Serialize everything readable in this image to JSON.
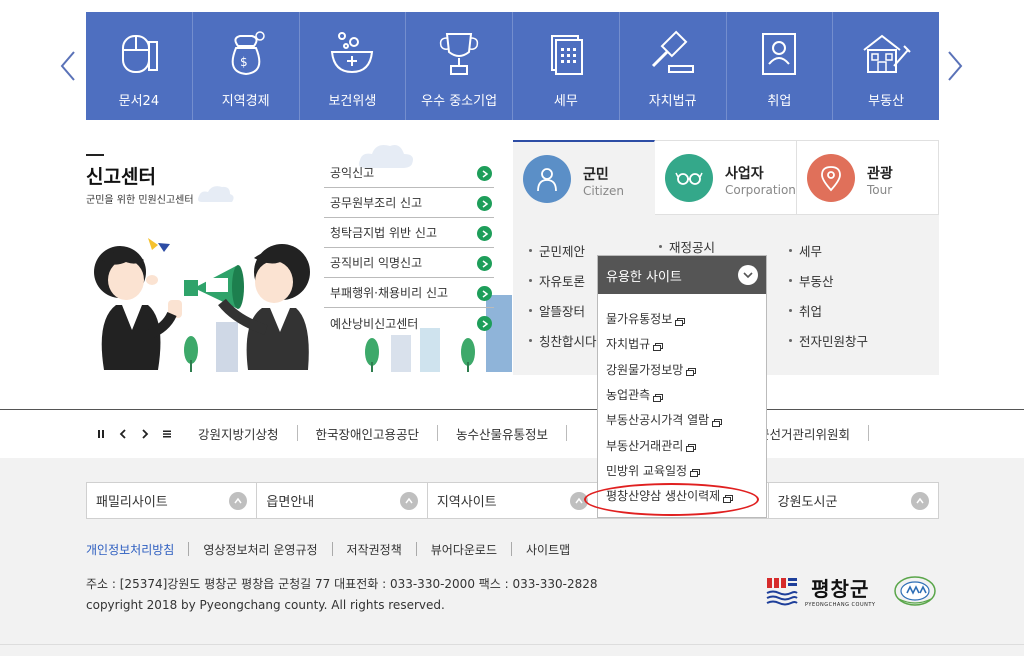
{
  "quick_menu": {
    "items": [
      {
        "label": "문서24",
        "icon": "mouse-document-icon"
      },
      {
        "label": "지역경제",
        "icon": "money-bag-icon"
      },
      {
        "label": "보건위생",
        "icon": "medicine-bowl-icon"
      },
      {
        "label": "우수 중소기업",
        "icon": "trophy-icon"
      },
      {
        "label": "세무",
        "icon": "tax-document-icon"
      },
      {
        "label": "자치법규",
        "icon": "gavel-icon"
      },
      {
        "label": "취업",
        "icon": "id-card-icon"
      },
      {
        "label": "부동산",
        "icon": "house-icon"
      }
    ]
  },
  "report_center": {
    "title": "신고센터",
    "subtitle": "군민을 위한 민원신고센터",
    "links": [
      "공익신고",
      "공무원부조리 신고",
      "청탁금지법 위반 신고",
      "공직비리 익명신고",
      "부패행위·채용비리 신고",
      "예산낭비신고센터"
    ]
  },
  "tabs": {
    "items": [
      {
        "name": "군민",
        "eng": "Citizen",
        "color": "#5b8fc7"
      },
      {
        "name": "사업자",
        "eng": "Corporation",
        "color": "#34a88a"
      },
      {
        "name": "관광",
        "eng": "Tour",
        "color": "#e0705a"
      }
    ],
    "col1": [
      "군민제안",
      "자유토론",
      "알뜰장터",
      "칭찬합시다"
    ],
    "col2": [
      "재정공시"
    ],
    "col3": [
      "세무",
      "부동산",
      "취업",
      "전자민원창구"
    ]
  },
  "dropdown": {
    "title": "유용한 사이트",
    "items": [
      "물가유통정보",
      "자치법규",
      "강원물가정보망",
      "농업관측",
      "부동산공시가격 열람",
      "부동산거래관리",
      "민방위 교육일정",
      "평창산양삼 생산이력제"
    ]
  },
  "rolling": {
    "items": [
      "강원지방기상청",
      "한국장애인고용공단",
      "농수산물유통정보",
      "평창군선거관리위원회"
    ]
  },
  "footer": {
    "selects": [
      "패밀리사이트",
      "읍면안내",
      "지역사이트",
      "",
      "강원도시군"
    ],
    "policy": [
      "개인정보처리방침",
      "영상정보처리 운영규정",
      "저작권정책",
      "뷰어다운로드",
      "사이트맵"
    ],
    "address": "주소 : [25374]강원도 평창군 평창읍 군청길 77 대표전화 : 033-330-2000 팩스 : 033-330-2828",
    "copyright": "copyright 2018 by Pyeongchang county. All rights reserved.",
    "logo_name": "평창군",
    "logo_eng": "PYEONGCHANG COUNTY"
  },
  "colors": {
    "quick_bar": "#4e6fc0",
    "accent_green": "#1e9e5a",
    "highlight_red": "#e02020"
  }
}
